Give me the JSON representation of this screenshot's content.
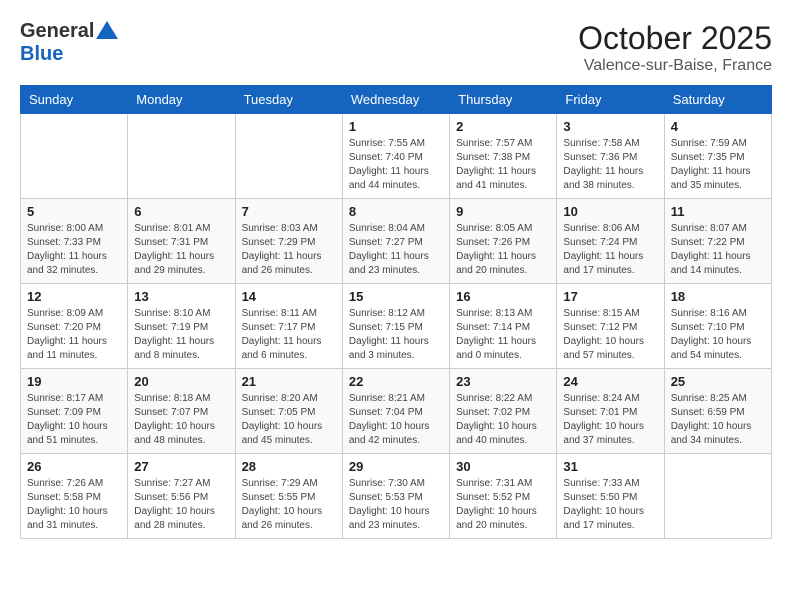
{
  "header": {
    "logo_general": "General",
    "logo_blue": "Blue",
    "month_title": "October 2025",
    "location": "Valence-sur-Baise, France"
  },
  "days_of_week": [
    "Sunday",
    "Monday",
    "Tuesday",
    "Wednesday",
    "Thursday",
    "Friday",
    "Saturday"
  ],
  "weeks": [
    [
      {
        "day": "",
        "info": ""
      },
      {
        "day": "",
        "info": ""
      },
      {
        "day": "",
        "info": ""
      },
      {
        "day": "1",
        "info": "Sunrise: 7:55 AM\nSunset: 7:40 PM\nDaylight: 11 hours\nand 44 minutes."
      },
      {
        "day": "2",
        "info": "Sunrise: 7:57 AM\nSunset: 7:38 PM\nDaylight: 11 hours\nand 41 minutes."
      },
      {
        "day": "3",
        "info": "Sunrise: 7:58 AM\nSunset: 7:36 PM\nDaylight: 11 hours\nand 38 minutes."
      },
      {
        "day": "4",
        "info": "Sunrise: 7:59 AM\nSunset: 7:35 PM\nDaylight: 11 hours\nand 35 minutes."
      }
    ],
    [
      {
        "day": "5",
        "info": "Sunrise: 8:00 AM\nSunset: 7:33 PM\nDaylight: 11 hours\nand 32 minutes."
      },
      {
        "day": "6",
        "info": "Sunrise: 8:01 AM\nSunset: 7:31 PM\nDaylight: 11 hours\nand 29 minutes."
      },
      {
        "day": "7",
        "info": "Sunrise: 8:03 AM\nSunset: 7:29 PM\nDaylight: 11 hours\nand 26 minutes."
      },
      {
        "day": "8",
        "info": "Sunrise: 8:04 AM\nSunset: 7:27 PM\nDaylight: 11 hours\nand 23 minutes."
      },
      {
        "day": "9",
        "info": "Sunrise: 8:05 AM\nSunset: 7:26 PM\nDaylight: 11 hours\nand 20 minutes."
      },
      {
        "day": "10",
        "info": "Sunrise: 8:06 AM\nSunset: 7:24 PM\nDaylight: 11 hours\nand 17 minutes."
      },
      {
        "day": "11",
        "info": "Sunrise: 8:07 AM\nSunset: 7:22 PM\nDaylight: 11 hours\nand 14 minutes."
      }
    ],
    [
      {
        "day": "12",
        "info": "Sunrise: 8:09 AM\nSunset: 7:20 PM\nDaylight: 11 hours\nand 11 minutes."
      },
      {
        "day": "13",
        "info": "Sunrise: 8:10 AM\nSunset: 7:19 PM\nDaylight: 11 hours\nand 8 minutes."
      },
      {
        "day": "14",
        "info": "Sunrise: 8:11 AM\nSunset: 7:17 PM\nDaylight: 11 hours\nand 6 minutes."
      },
      {
        "day": "15",
        "info": "Sunrise: 8:12 AM\nSunset: 7:15 PM\nDaylight: 11 hours\nand 3 minutes."
      },
      {
        "day": "16",
        "info": "Sunrise: 8:13 AM\nSunset: 7:14 PM\nDaylight: 11 hours\nand 0 minutes."
      },
      {
        "day": "17",
        "info": "Sunrise: 8:15 AM\nSunset: 7:12 PM\nDaylight: 10 hours\nand 57 minutes."
      },
      {
        "day": "18",
        "info": "Sunrise: 8:16 AM\nSunset: 7:10 PM\nDaylight: 10 hours\nand 54 minutes."
      }
    ],
    [
      {
        "day": "19",
        "info": "Sunrise: 8:17 AM\nSunset: 7:09 PM\nDaylight: 10 hours\nand 51 minutes."
      },
      {
        "day": "20",
        "info": "Sunrise: 8:18 AM\nSunset: 7:07 PM\nDaylight: 10 hours\nand 48 minutes."
      },
      {
        "day": "21",
        "info": "Sunrise: 8:20 AM\nSunset: 7:05 PM\nDaylight: 10 hours\nand 45 minutes."
      },
      {
        "day": "22",
        "info": "Sunrise: 8:21 AM\nSunset: 7:04 PM\nDaylight: 10 hours\nand 42 minutes."
      },
      {
        "day": "23",
        "info": "Sunrise: 8:22 AM\nSunset: 7:02 PM\nDaylight: 10 hours\nand 40 minutes."
      },
      {
        "day": "24",
        "info": "Sunrise: 8:24 AM\nSunset: 7:01 PM\nDaylight: 10 hours\nand 37 minutes."
      },
      {
        "day": "25",
        "info": "Sunrise: 8:25 AM\nSunset: 6:59 PM\nDaylight: 10 hours\nand 34 minutes."
      }
    ],
    [
      {
        "day": "26",
        "info": "Sunrise: 7:26 AM\nSunset: 5:58 PM\nDaylight: 10 hours\nand 31 minutes."
      },
      {
        "day": "27",
        "info": "Sunrise: 7:27 AM\nSunset: 5:56 PM\nDaylight: 10 hours\nand 28 minutes."
      },
      {
        "day": "28",
        "info": "Sunrise: 7:29 AM\nSunset: 5:55 PM\nDaylight: 10 hours\nand 26 minutes."
      },
      {
        "day": "29",
        "info": "Sunrise: 7:30 AM\nSunset: 5:53 PM\nDaylight: 10 hours\nand 23 minutes."
      },
      {
        "day": "30",
        "info": "Sunrise: 7:31 AM\nSunset: 5:52 PM\nDaylight: 10 hours\nand 20 minutes."
      },
      {
        "day": "31",
        "info": "Sunrise: 7:33 AM\nSunset: 5:50 PM\nDaylight: 10 hours\nand 17 minutes."
      },
      {
        "day": "",
        "info": ""
      }
    ]
  ]
}
